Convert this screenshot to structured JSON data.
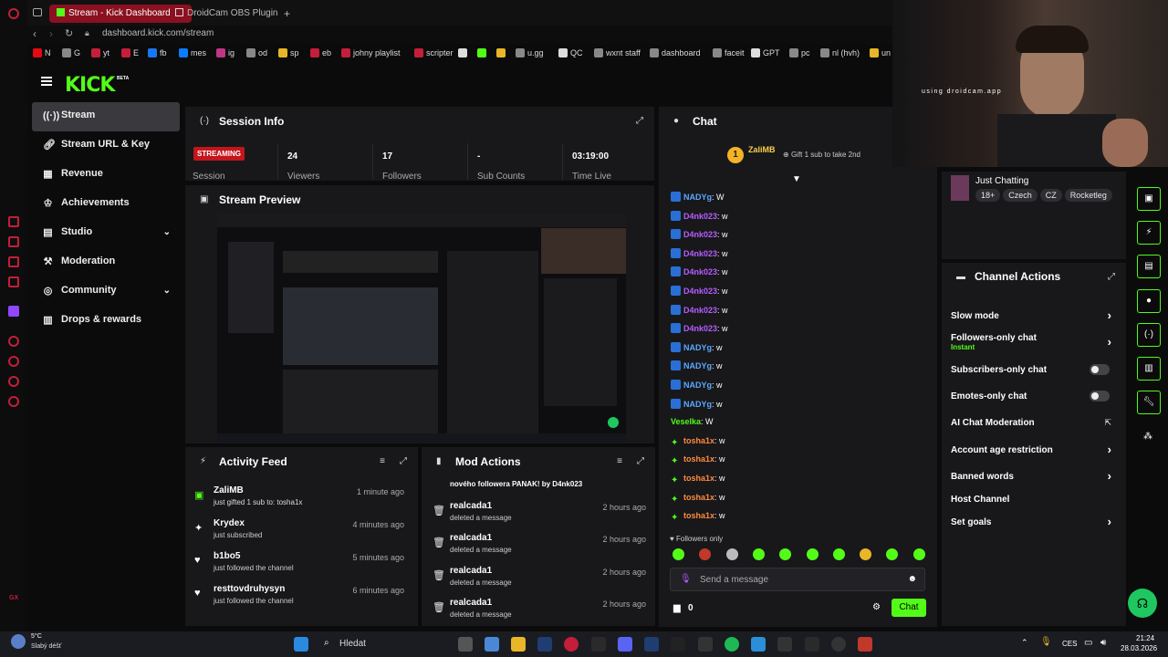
{
  "browser": {
    "tabs": [
      {
        "label": "Stream - Kick Dashboard"
      },
      {
        "label": "DroidCam OBS Plugin | De"
      }
    ],
    "url": "dashboard.kick.com/stream",
    "bookmarks": [
      "N",
      "G",
      "yt",
      "E",
      "fb",
      "mes",
      "ig",
      "od",
      "sp",
      "eb",
      "johny playlist",
      "scripter",
      "",
      "",
      "",
      "u.gg",
      "QC",
      "wxnt staff",
      "dashboard",
      "faceit",
      "GPT",
      "pc",
      "nl (hvh)",
      "un"
    ]
  },
  "kick": {
    "logo": "KICK",
    "beta": "BETA"
  },
  "sidebar": {
    "items": [
      {
        "label": "Stream"
      },
      {
        "label": "Stream URL & Key"
      },
      {
        "label": "Revenue"
      },
      {
        "label": "Achievements"
      },
      {
        "label": "Studio"
      },
      {
        "label": "Moderation"
      },
      {
        "label": "Community"
      },
      {
        "label": "Drops & rewards"
      }
    ]
  },
  "session": {
    "title": "Session Info",
    "status": "STREAMING",
    "status_label": "Session",
    "stats": [
      {
        "value": "24",
        "label": "Viewers"
      },
      {
        "value": "17",
        "label": "Followers"
      },
      {
        "value": "-",
        "label": "Sub Counts"
      },
      {
        "value": "03:19:00",
        "label": "Time Live"
      }
    ]
  },
  "preview": {
    "title": "Stream Preview"
  },
  "activity": {
    "title": "Activity Feed",
    "items": [
      {
        "name": "ZaliMB",
        "sub": "just gifted 1 sub to: tosha1x",
        "time": "1 minute ago"
      },
      {
        "name": "Krydex",
        "sub": "just subscribed",
        "time": "4 minutes ago"
      },
      {
        "name": "b1bo5",
        "sub": "just followed the channel",
        "time": "5 minutes ago"
      },
      {
        "name": "resttovdruhysyn",
        "sub": "just followed the channel",
        "time": "6 minutes ago"
      }
    ]
  },
  "mod": {
    "title": "Mod Actions",
    "top": "nového followera PANAK! by D4nk023",
    "items": [
      {
        "name": "realcada1",
        "sub": "deleted a message",
        "time": "2 hours ago"
      },
      {
        "name": "realcada1",
        "sub": "deleted a message",
        "time": "2 hours ago"
      },
      {
        "name": "realcada1",
        "sub": "deleted a message",
        "time": "2 hours ago"
      },
      {
        "name": "realcada1",
        "sub": "deleted a message",
        "time": "2 hours ago"
      }
    ]
  },
  "chat": {
    "title": "Chat",
    "gifter": "ZaliMB",
    "gifter_count": "1",
    "gift_cta": "Gift 1 sub to take 2nd",
    "lines": [
      {
        "user": "NADYg",
        "msg": ": W",
        "color": "#5aa9ff"
      },
      {
        "user": "D4nk023",
        "msg": ": w",
        "color": "#b65cff"
      },
      {
        "user": "D4nk023",
        "msg": ": w",
        "color": "#b65cff"
      },
      {
        "user": "D4nk023",
        "msg": ": w",
        "color": "#b65cff"
      },
      {
        "user": "D4nk023",
        "msg": ": w",
        "color": "#b65cff"
      },
      {
        "user": "D4nk023",
        "msg": ": w",
        "color": "#b65cff"
      },
      {
        "user": "D4nk023",
        "msg": ": w",
        "color": "#b65cff"
      },
      {
        "user": "D4nk023",
        "msg": ": w",
        "color": "#b65cff"
      },
      {
        "user": "NADYg",
        "msg": ": w",
        "color": "#5aa9ff"
      },
      {
        "user": "NADYg",
        "msg": ": w",
        "color": "#5aa9ff"
      },
      {
        "user": "NADYg",
        "msg": ": w",
        "color": "#5aa9ff"
      },
      {
        "user": "NADYg",
        "msg": ": w",
        "color": "#5aa9ff"
      },
      {
        "user": "Veselka",
        "msg": ": W",
        "color": "#53fc18"
      },
      {
        "user": "tosha1x",
        "msg": ": w",
        "color": "#ff8a3d"
      },
      {
        "user": "tosha1x",
        "msg": ": w",
        "color": "#ff8a3d"
      },
      {
        "user": "tosha1x",
        "msg": ": w",
        "color": "#ff8a3d"
      },
      {
        "user": "tosha1x",
        "msg": ": w",
        "color": "#ff8a3d"
      },
      {
        "user": "tosha1x",
        "msg": ": w",
        "color": "#ff8a3d"
      }
    ],
    "followers_only": "Followers only",
    "placeholder": "Send a message",
    "points": "0",
    "send": "Chat"
  },
  "stream_info": {
    "category": "Just Chatting",
    "tags": [
      "18+",
      "Czech",
      "CZ",
      "Rocketleg"
    ]
  },
  "actions": {
    "title": "Channel Actions",
    "items": [
      {
        "label": "Slow mode"
      },
      {
        "label": "Followers-only chat",
        "sub": "Instant"
      },
      {
        "label": "Subscribers-only chat"
      },
      {
        "label": "Emotes-only chat"
      },
      {
        "label": "AI Chat Moderation"
      },
      {
        "label": "Account age restriction"
      },
      {
        "label": "Banned words"
      },
      {
        "label": "Host Channel"
      },
      {
        "label": "Set goals"
      }
    ]
  },
  "webcam": {
    "caption": "using droidcam.app"
  },
  "taskbar": {
    "temp": "5°C",
    "weather": "Slabý déšť",
    "search": "Hledat",
    "lang": "CES",
    "time": "21:24",
    "date": "28.03.2026"
  }
}
